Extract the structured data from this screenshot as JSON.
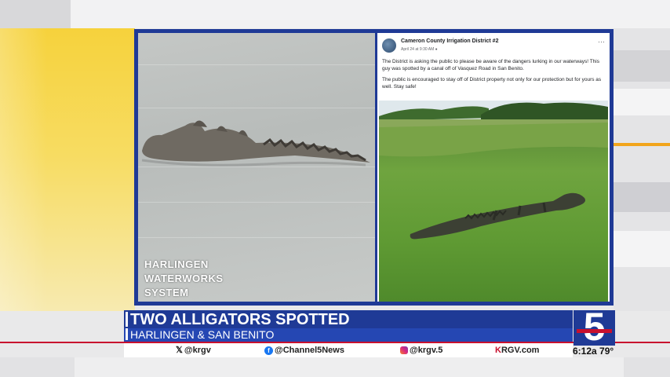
{
  "colors": {
    "brand_blue": "#1f3a96",
    "brand_red": "#c8102e",
    "accent_yellow": "#f6d23c"
  },
  "screen": {
    "left_photo": {
      "watermark_lines": [
        "HARLINGEN",
        "WATERWORKS",
        "SYSTEM"
      ]
    },
    "facebook_post": {
      "author": "Cameron County Irrigation District #2",
      "date": "April 24 at 9:30 AM",
      "paragraph_1": "The District is asking the public to please be aware of the dangers lurking in our waterways! This guy was spotted by a canal off of Vasquez Road in San Benito.",
      "paragraph_2": "The public is encouraged to stay off of District property not only for our protection but for yours as well. Stay safe!",
      "more_icon": "ellipsis-icon"
    }
  },
  "lower_third": {
    "headline": "TWO ALLIGATORS SPOTTED",
    "subhead": "HARLINGEN & SAN BENITO"
  },
  "social": {
    "x_handle": "@krgv",
    "facebook_handle": "@Channel5News",
    "instagram_handle": "@krgv.5",
    "website_k": "K",
    "website_rest": "RGV.com"
  },
  "logo": {
    "channel_number": "5"
  },
  "clock": {
    "time_temp": "6:12a 79°"
  }
}
